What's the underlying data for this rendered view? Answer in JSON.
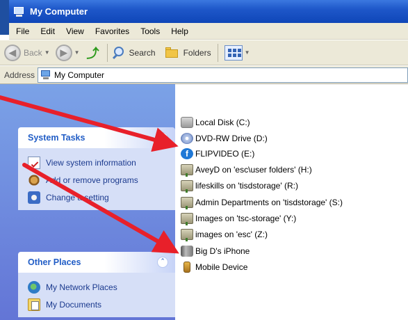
{
  "window": {
    "title": "My Computer"
  },
  "menu": [
    "File",
    "Edit",
    "View",
    "Favorites",
    "Tools",
    "Help"
  ],
  "toolbar": {
    "back_label": "Back",
    "search_label": "Search",
    "folders_label": "Folders"
  },
  "address": {
    "label": "Address",
    "value": "My Computer"
  },
  "system_tasks": {
    "title": "System Tasks",
    "items": [
      "View system information",
      "Add or remove programs",
      "Change a setting"
    ]
  },
  "other_places": {
    "title": "Other Places",
    "items": [
      "My Network Places",
      "My Documents"
    ]
  },
  "files": [
    {
      "name": "Local Disk (C:)",
      "icon": "hard-disk-icon"
    },
    {
      "name": "DVD-RW Drive (D:)",
      "icon": "dvd-drive-icon"
    },
    {
      "name": "FLIPVIDEO (E:)",
      "icon": "flipvideo-icon"
    },
    {
      "name": "AveyD on 'esc\\user folders' (H:)",
      "icon": "network-drive-icon"
    },
    {
      "name": "lifeskills on 'tisdstorage' (R:)",
      "icon": "network-drive-icon"
    },
    {
      "name": "Admin Departments on 'tisdstorage' (S:)",
      "icon": "network-drive-icon"
    },
    {
      "name": "Images on 'tsc-storage' (Y:)",
      "icon": "network-drive-icon"
    },
    {
      "name": "images on 'esc' (Z:)",
      "icon": "network-drive-icon"
    },
    {
      "name": "Big D's iPhone",
      "icon": "iphone-icon"
    },
    {
      "name": "Mobile Device",
      "icon": "mobile-device-icon"
    }
  ],
  "annotation_color": "#e8202a"
}
